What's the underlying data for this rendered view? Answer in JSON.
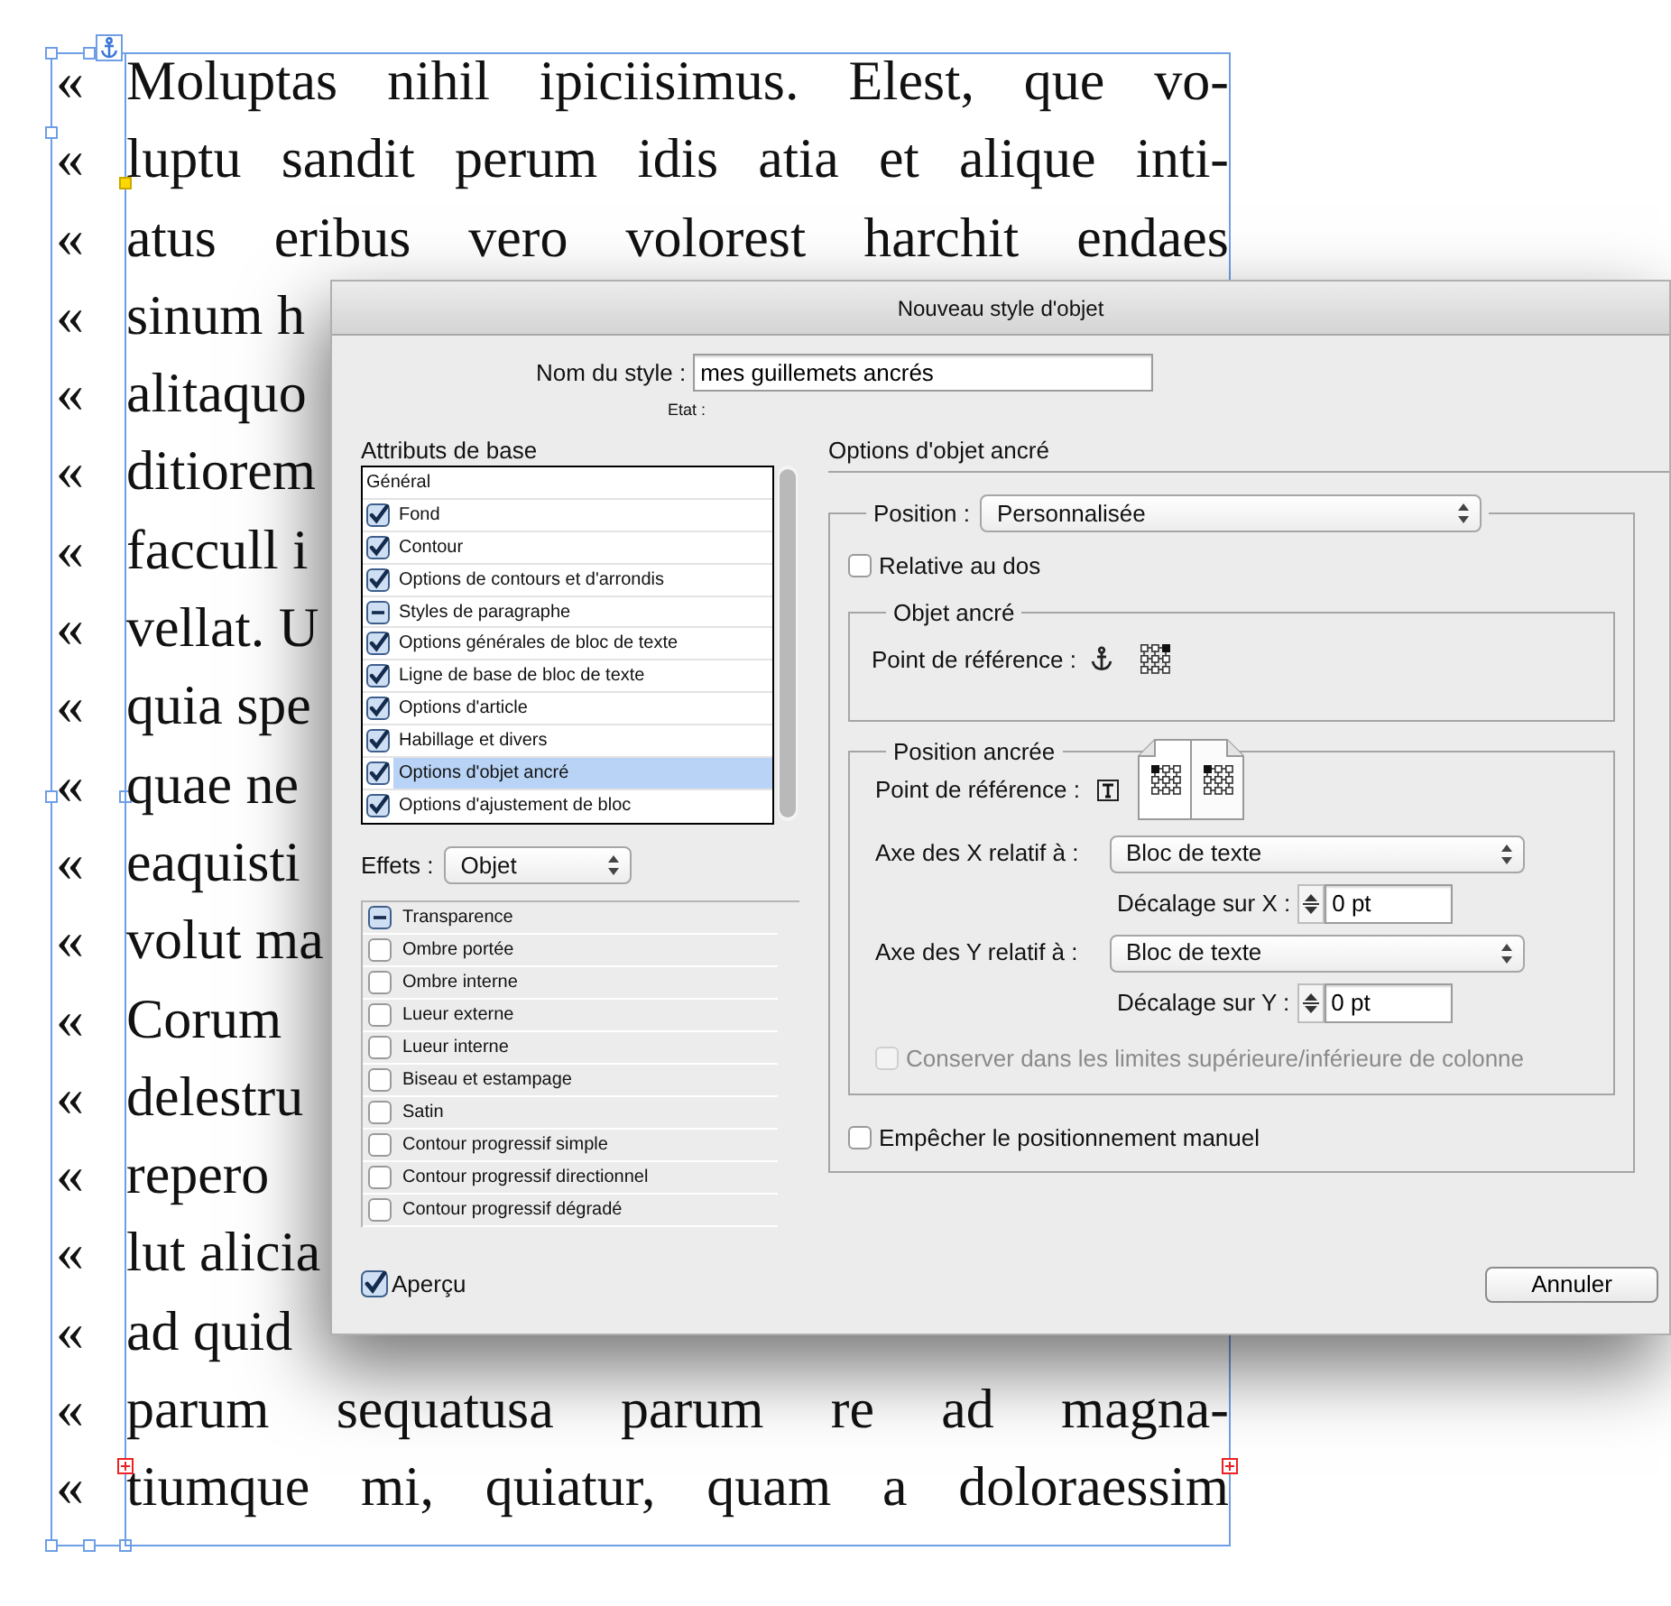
{
  "document": {
    "lines": [
      {
        "mark": "«",
        "text": "Moluptas nihil ipiciisimus. Elest, que vo-",
        "full": true
      },
      {
        "mark": "«",
        "text": "luptu sandit perum idis atia et alique inti-",
        "full": true
      },
      {
        "mark": "«",
        "text": "atus eribus vero volorest harchit endaes",
        "full": true
      },
      {
        "mark": "«",
        "text": "sinum h",
        "full": false
      },
      {
        "mark": "«",
        "text": "alitaquo",
        "full": false
      },
      {
        "mark": "«",
        "text": "ditiorem",
        "full": false
      },
      {
        "mark": "«",
        "text": "faccull i",
        "full": false
      },
      {
        "mark": "«",
        "text": "vellat. U",
        "full": false
      },
      {
        "mark": "«",
        "text": "quia spe",
        "full": false
      },
      {
        "mark": "«",
        "text": "quae ne",
        "full": false
      },
      {
        "mark": "«",
        "text": "eaquisti",
        "full": false
      },
      {
        "mark": "«",
        "text": "volut ma",
        "full": false
      },
      {
        "mark": "«",
        "text": "Corum",
        "full": false
      },
      {
        "mark": "«",
        "text": "delestru",
        "full": false
      },
      {
        "mark": "«",
        "text": "repero",
        "full": false
      },
      {
        "mark": "«",
        "text": "lut alicia",
        "full": false
      },
      {
        "mark": "«",
        "text": "ad quid",
        "full": false
      },
      {
        "mark": "«",
        "text": "parum sequatusa parum re ad magna-",
        "full": true
      },
      {
        "mark": "«",
        "text": "tiumque mi, quiatur, quam a doloraessim",
        "full": true
      }
    ]
  },
  "dialog": {
    "title": "Nouveau style d'objet",
    "style_name": {
      "label": "Nom du style :",
      "value": "mes guillemets ancrés"
    },
    "state_label": "Etat :",
    "basic_attributes": {
      "heading": "Attributs de base",
      "items": [
        {
          "kind": "header",
          "label": "Général"
        },
        {
          "kind": "check",
          "label": "Fond",
          "checked": true,
          "mixed": false,
          "selected": false
        },
        {
          "kind": "check",
          "label": "Contour",
          "checked": true,
          "mixed": false,
          "selected": false
        },
        {
          "kind": "check",
          "label": "Options de contours et d'arrondis",
          "checked": true,
          "mixed": false,
          "selected": false
        },
        {
          "kind": "check",
          "label": "Styles de paragraphe",
          "mixed": true,
          "selected": false
        },
        {
          "kind": "check",
          "label": "Options générales de bloc de texte",
          "checked": true,
          "mixed": false,
          "selected": false
        },
        {
          "kind": "check",
          "label": "Ligne de base de bloc de texte",
          "checked": true,
          "mixed": false,
          "selected": false
        },
        {
          "kind": "check",
          "label": "Options d'article",
          "checked": true,
          "mixed": false,
          "selected": false
        },
        {
          "kind": "check",
          "label": "Habillage et divers",
          "checked": true,
          "mixed": false,
          "selected": false
        },
        {
          "kind": "check",
          "label": "Options d'objet ancré",
          "checked": true,
          "mixed": false,
          "selected": true
        },
        {
          "kind": "check",
          "label": "Options d'ajustement de bloc",
          "checked": true,
          "mixed": false,
          "selected": false
        }
      ]
    },
    "effects": {
      "label": "Effets :",
      "value": "Objet",
      "items": [
        {
          "label": "Transparence",
          "mixed": true
        },
        {
          "label": "Ombre portée",
          "checked": false,
          "mixed": false
        },
        {
          "label": "Ombre interne",
          "checked": false,
          "mixed": false
        },
        {
          "label": "Lueur externe",
          "checked": false,
          "mixed": false
        },
        {
          "label": "Lueur interne",
          "checked": false,
          "mixed": false
        },
        {
          "label": "Biseau et estampage",
          "checked": false,
          "mixed": false
        },
        {
          "label": "Satin",
          "checked": false,
          "mixed": false
        },
        {
          "label": "Contour progressif simple",
          "checked": false,
          "mixed": false
        },
        {
          "label": "Contour progressif directionnel",
          "checked": false,
          "mixed": false
        },
        {
          "label": "Contour progressif dégradé",
          "checked": false,
          "mixed": false
        }
      ]
    },
    "preview": {
      "label": "Aperçu",
      "checked": true
    },
    "anchored": {
      "heading": "Options d'objet ancré",
      "position": {
        "label": "Position :",
        "value": "Personnalisée"
      },
      "relative_to_spine": {
        "label": "Relative au dos",
        "checked": false
      },
      "anchored_object": {
        "legend": "Objet ancré",
        "label": "Point de référence :",
        "reference_cells": [
          {
            "selected": false
          },
          {
            "selected": false
          },
          {
            "selected": true
          },
          {
            "selected": false
          },
          {
            "selected": false
          },
          {
            "selected": false
          },
          {
            "selected": false
          },
          {
            "selected": false
          },
          {
            "selected": false
          }
        ]
      },
      "anchored_position": {
        "legend": "Position ancrée",
        "label": "Point de référence :",
        "left_page_cells": [
          {
            "selected": true
          },
          {
            "selected": false
          },
          {
            "selected": false
          },
          {
            "selected": false
          },
          {
            "selected": false
          },
          {
            "selected": false
          },
          {
            "selected": false
          },
          {
            "selected": false
          },
          {
            "selected": false
          }
        ],
        "right_page_cells": [
          {
            "selected": true
          },
          {
            "selected": false
          },
          {
            "selected": false
          },
          {
            "selected": false
          },
          {
            "selected": false
          },
          {
            "selected": false
          },
          {
            "selected": false
          },
          {
            "selected": false
          },
          {
            "selected": false
          }
        ],
        "x_axis": {
          "label": "Axe des X relatif à :",
          "value": "Bloc de texte"
        },
        "x_offset": {
          "label": "Décalage sur X :",
          "value": "0 pt"
        },
        "y_axis": {
          "label": "Axe des Y relatif à :",
          "value": "Bloc de texte"
        },
        "y_offset": {
          "label": "Décalage sur Y :",
          "value": "0 pt"
        },
        "keep_within_column": {
          "label": "Conserver dans les limites supérieure/inférieure de colonne",
          "checked": false,
          "disabled": true
        }
      },
      "prevent_manual": {
        "label": "Empêcher le positionnement manuel",
        "checked": false
      }
    },
    "buttons": [
      "Annuler"
    ]
  }
}
